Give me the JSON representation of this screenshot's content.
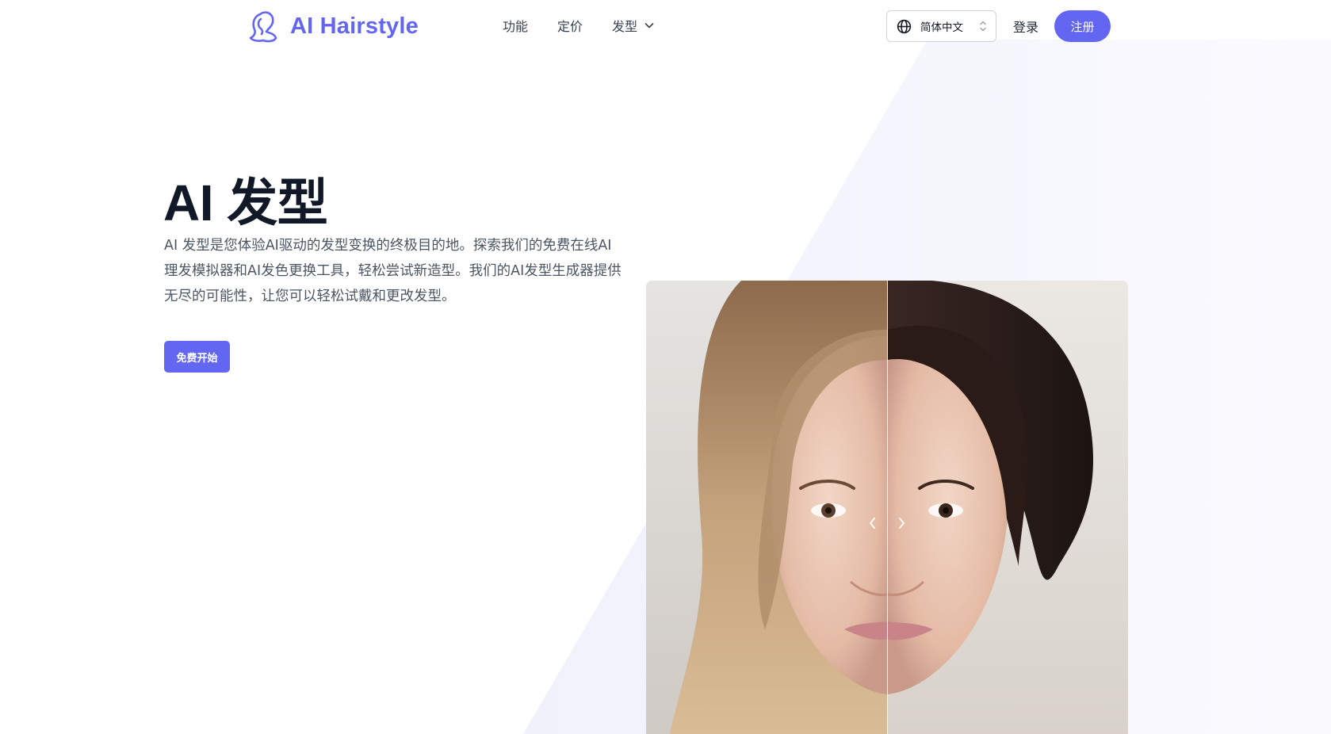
{
  "brand": {
    "name": "AI Hairstyle",
    "accent_color": "#6366f1",
    "logo_icon": "woman-silhouette-icon"
  },
  "nav": {
    "items": [
      {
        "label": "功能"
      },
      {
        "label": "定价"
      },
      {
        "label": "发型",
        "icon": "chevron-down-icon"
      }
    ]
  },
  "header_actions": {
    "language": {
      "selected": "简体中文",
      "icon": "globe-icon",
      "toggle_icon": "chevron-up-down-icon"
    },
    "login_label": "登录",
    "signup_label": "注册"
  },
  "hero": {
    "title": "AI 发型",
    "description": "AI 发型是您体验AI驱动的发型变换的终极目的地。探索我们的免费在线AI理发模拟器和AI发色更换工具，轻松尝试新造型。我们的AI发型生成器提供无尽的可能性，让您可以轻松试戴和更改发型。",
    "cta_label": "免费开始"
  },
  "compare": {
    "prev_icon": "chevron-left-icon",
    "next_icon": "chevron-right-icon"
  }
}
